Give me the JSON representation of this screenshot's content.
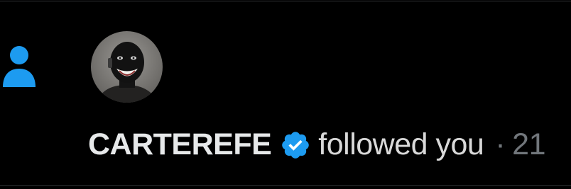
{
  "notification": {
    "type_icon": "person-icon",
    "user": {
      "name": "CARTEREFE",
      "verified": true,
      "avatar_icon": "avatar"
    },
    "action": "followed you",
    "separator": "·",
    "time": "21"
  },
  "colors": {
    "background": "#000000",
    "accent": "#1d9bf0",
    "primary_text": "#e7e9ea",
    "secondary_text": "#71767b",
    "divider": "#2f3336"
  }
}
